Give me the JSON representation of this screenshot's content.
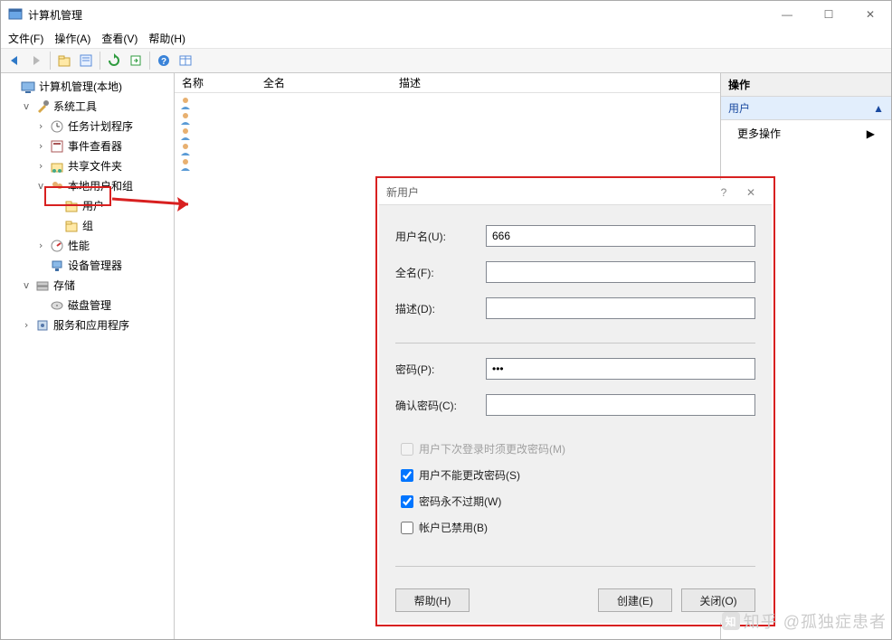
{
  "window": {
    "title": "计算机管理",
    "minimize": "—",
    "maximize": "☐",
    "close": "✕"
  },
  "menu": {
    "file": "文件(F)",
    "action": "操作(A)",
    "view": "查看(V)",
    "help": "帮助(H)"
  },
  "toolbar_icons": {
    "back": "back-arrow-icon",
    "forward": "forward-arrow-icon",
    "up": "up-folder-icon",
    "props": "properties-icon",
    "refresh": "refresh-icon",
    "export": "export-icon",
    "help": "help-icon",
    "grid": "grid-icon"
  },
  "tree": {
    "root": "计算机管理(本地)",
    "system_tools": "系统工具",
    "task_scheduler": "任务计划程序",
    "event_viewer": "事件查看器",
    "shared_folders": "共享文件夹",
    "local_users_groups": "本地用户和组",
    "users": "用户",
    "groups": "组",
    "performance": "性能",
    "device_manager": "设备管理器",
    "storage": "存储",
    "disk_management": "磁盘管理",
    "services_apps": "服务和应用程序"
  },
  "list_columns": {
    "name": "名称",
    "full_name": "全名",
    "description": "描述"
  },
  "actions_pane": {
    "header": "操作",
    "subject": "用户",
    "more": "更多操作"
  },
  "dialog": {
    "title": "新用户",
    "help_tip": "?",
    "close_tip": "✕",
    "labels": {
      "username": "用户名(U):",
      "fullname": "全名(F):",
      "description": "描述(D):",
      "password": "密码(P):",
      "confirm": "确认密码(C):"
    },
    "values": {
      "username": "666",
      "fullname": "",
      "description": "",
      "password": "•••",
      "confirm": ""
    },
    "checkboxes": {
      "must_change": "用户下次登录时须更改密码(M)",
      "cannot_change": "用户不能更改密码(S)",
      "never_expires": "密码永不过期(W)",
      "disabled": "帐户已禁用(B)"
    },
    "buttons": {
      "help": "帮助(H)",
      "create": "创建(E)",
      "close": "关闭(O)"
    }
  },
  "watermark": "知乎 @孤独症患者"
}
